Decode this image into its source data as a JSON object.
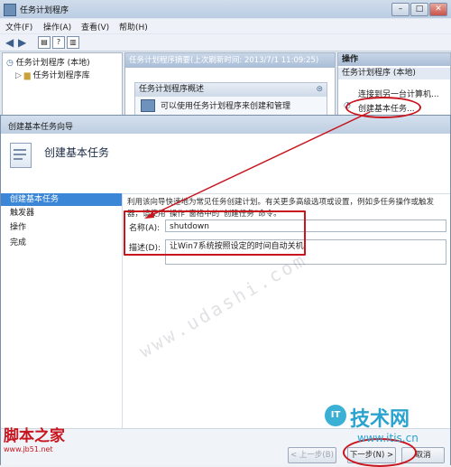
{
  "main_window": {
    "title": "任务计划程序",
    "controls": {
      "minimize": "–",
      "maximize": "□",
      "close": "✕"
    },
    "menu": [
      "文件(F)",
      "操作(A)",
      "查看(V)",
      "帮助(H)"
    ],
    "tree": {
      "root": "任务计划程序 (本地)",
      "library": "任务计划程序库"
    },
    "center_header": "任务计划程序摘要(上次刷新时间: 2013/7/1 11:09:25)",
    "overview_title": "任务计划程序概述",
    "overview_text": "可以使用任务计划程序来创建和管理",
    "actions": {
      "header": "操作",
      "sub_header": "任务计划程序 (本地)",
      "items": [
        "连接到另一台计算机...",
        "创建基本任务..."
      ]
    }
  },
  "wizard": {
    "title": "创建基本任务向导",
    "banner_title": "创建基本任务",
    "nav": [
      "创建基本任务",
      "触发器",
      "操作",
      "完成"
    ],
    "description": "利用该向导快速地为常见任务创建计划。有关更多高级选项或设置，例如多任务操作或触发器，请使用“操作”窗格中的“创建任务”命令。",
    "name_label": "名称(A):",
    "name_value": "shutdown",
    "desc_label": "描述(D):",
    "desc_value": "让Win7系统按照设定的时间自动关机",
    "buttons": {
      "back": "< 上一步(B)",
      "next": "下一步(N) >",
      "cancel": "取消"
    }
  },
  "watermarks": {
    "site": "www.udashi.com",
    "logo_left_cn": "脚本之家",
    "logo_left_url": "www.jb51.net",
    "logo_right_badge": "IT",
    "logo_right_name": "技术网",
    "logo_right_url": "www.itis.cn"
  },
  "colors": {
    "annotation_red": "#c8161f",
    "nav_active": "#3b86d6"
  }
}
